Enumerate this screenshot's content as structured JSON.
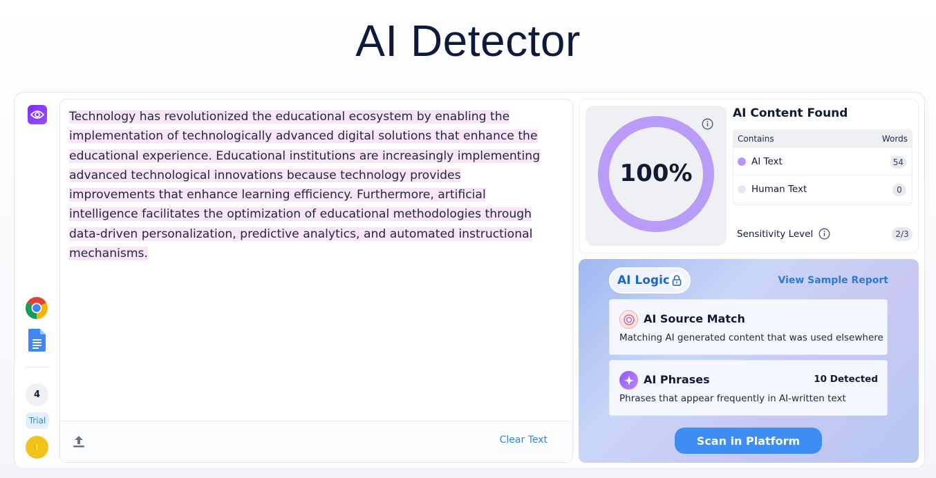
{
  "page": {
    "title": "AI Detector"
  },
  "rail": {
    "count": "4",
    "trial_label": "Trial",
    "avatar_initial": "I"
  },
  "editor": {
    "text": "Technology has revolutionized the educational ecosystem by enabling the implementation of technologically advanced digital solutions that enhance the educational experience. Educational institutions are increasingly implementing advanced technological innovations because technology provides improvements that enhance learning efficiency. Furthermore, artificial intelligence facilitates the optimization of educational methodologies through data-driven personalization, predictive analytics, and automated instructional mechanisms.",
    "clear_label": "Clear Text"
  },
  "result": {
    "percent_label": "100%",
    "ai_fraction": 1.0,
    "found_title": "AI Content Found",
    "table_header_left": "Contains",
    "table_header_right": "Words",
    "rows": [
      {
        "label": "AI Text",
        "count": "54",
        "color": "#b794f6"
      },
      {
        "label": "Human Text",
        "count": "0",
        "color": "#e3e8f4"
      }
    ],
    "sensitivity_label": "Sensitivity Level",
    "sensitivity_value": "2/3"
  },
  "logic": {
    "pill_label": "AI Logic",
    "view_report_label": "View Sample Report",
    "features": [
      {
        "title": "AI Source Match",
        "desc": "Matching AI generated content that was used elsewhere",
        "count": ""
      },
      {
        "title": "AI Phrases",
        "desc": "Phrases that appear frequently in AI-written text",
        "count": "10 Detected"
      }
    ],
    "scan_label": "Scan in Platform"
  },
  "colors": {
    "accent": "#2f86e0",
    "gauge": "#b99cf8",
    "brand_purple": "#7b2ff7",
    "scan_button": "#3d8df2"
  }
}
